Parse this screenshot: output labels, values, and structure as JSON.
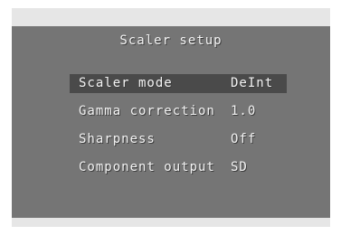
{
  "osd": {
    "title": "Scaler setup",
    "items": [
      {
        "label": "Scaler mode",
        "value": "DeInt",
        "selected": true
      },
      {
        "label": "Gamma correction",
        "value": "1.0",
        "selected": false
      },
      {
        "label": "Sharpness",
        "value": "Off",
        "selected": false
      },
      {
        "label": "Component output",
        "value": "SD",
        "selected": false
      }
    ]
  },
  "colors": {
    "panel": "#757575",
    "highlight": "#4a4a4a",
    "text": "#f4f4f4",
    "band": "#e6e6e6"
  }
}
